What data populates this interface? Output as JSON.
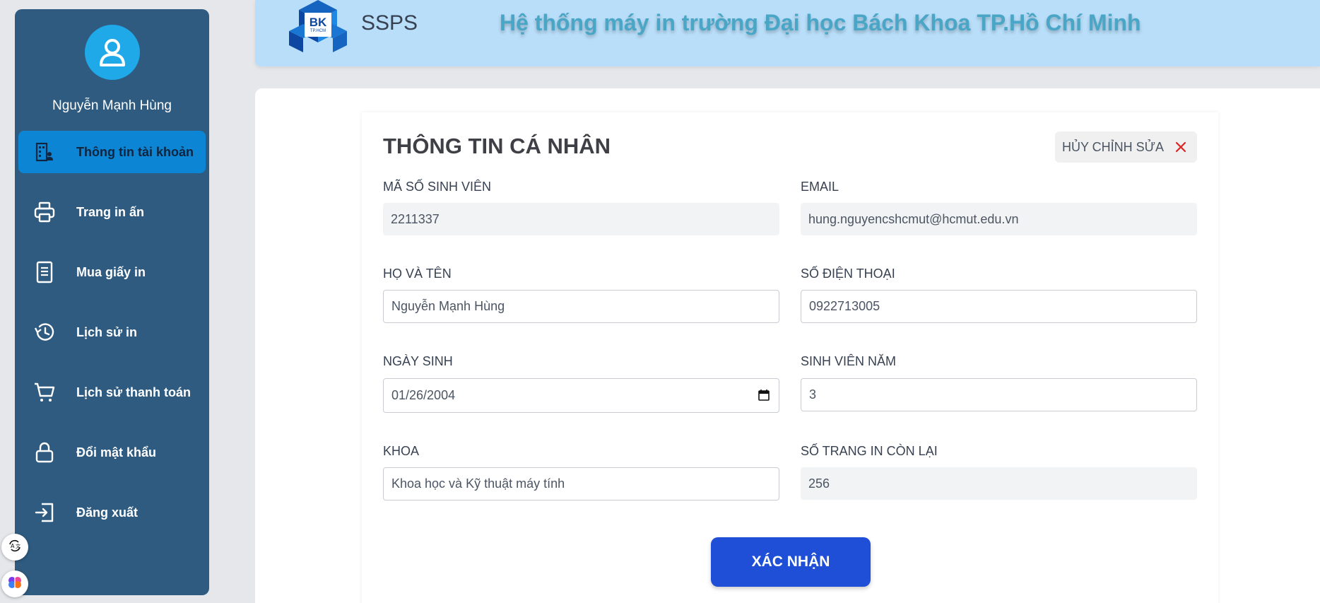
{
  "user": {
    "name": "Nguyễn Mạnh Hùng"
  },
  "sidebar": {
    "items": [
      {
        "label": "Thông tin tài khoản",
        "icon": "building-user-icon",
        "active": true
      },
      {
        "label": "Trang in ấn",
        "icon": "printer-icon"
      },
      {
        "label": "Mua giấy in",
        "icon": "document-icon"
      },
      {
        "label": "Lịch sử in",
        "icon": "history-icon"
      },
      {
        "label": "Lịch sử thanh toán",
        "icon": "cart-icon"
      },
      {
        "label": "Đổi mật khẩu",
        "icon": "lock-icon"
      },
      {
        "label": "Đăng xuất",
        "icon": "logout-icon"
      }
    ]
  },
  "header": {
    "logo_text": "BK",
    "logo_sub": "TP.HCM",
    "brand": "SSPS",
    "title": "Hệ thống máy in trường Đại học Bách Khoa TP.Hồ Chí Minh"
  },
  "form": {
    "title": "THÔNG TIN CÁ NHÂN",
    "cancel_label": "HỦY CHỈNH SỬA",
    "fields": {
      "student_id": {
        "label": "MÃ SỐ SINH VIÊN",
        "value": "2211337"
      },
      "email": {
        "label": "EMAIL",
        "value": "hung.nguyencshcmut@hcmut.edu.vn"
      },
      "full_name": {
        "label": "HỌ VÀ TÊN",
        "value": "Nguyễn Mạnh Hùng"
      },
      "phone": {
        "label": "SỐ ĐIỆN THOẠI",
        "value": "0922713005"
      },
      "birthday": {
        "label": "NGÀY SINH",
        "value": "01/26/2004"
      },
      "year": {
        "label": "SINH VIÊN NĂM",
        "value": "3"
      },
      "faculty": {
        "label": "KHOA",
        "value": "Khoa học và Kỹ thuật máy tính"
      },
      "pages_left": {
        "label": "SỐ TRANG IN CÒN LẠI",
        "value": "256"
      }
    },
    "confirm_label": "XÁC NHẬN"
  },
  "colors": {
    "sidebar": "#2f5b80",
    "active": "#0c86d4",
    "header": "#b9def9",
    "primary": "#1e4fd6",
    "cancel_x": "#dc2626"
  }
}
